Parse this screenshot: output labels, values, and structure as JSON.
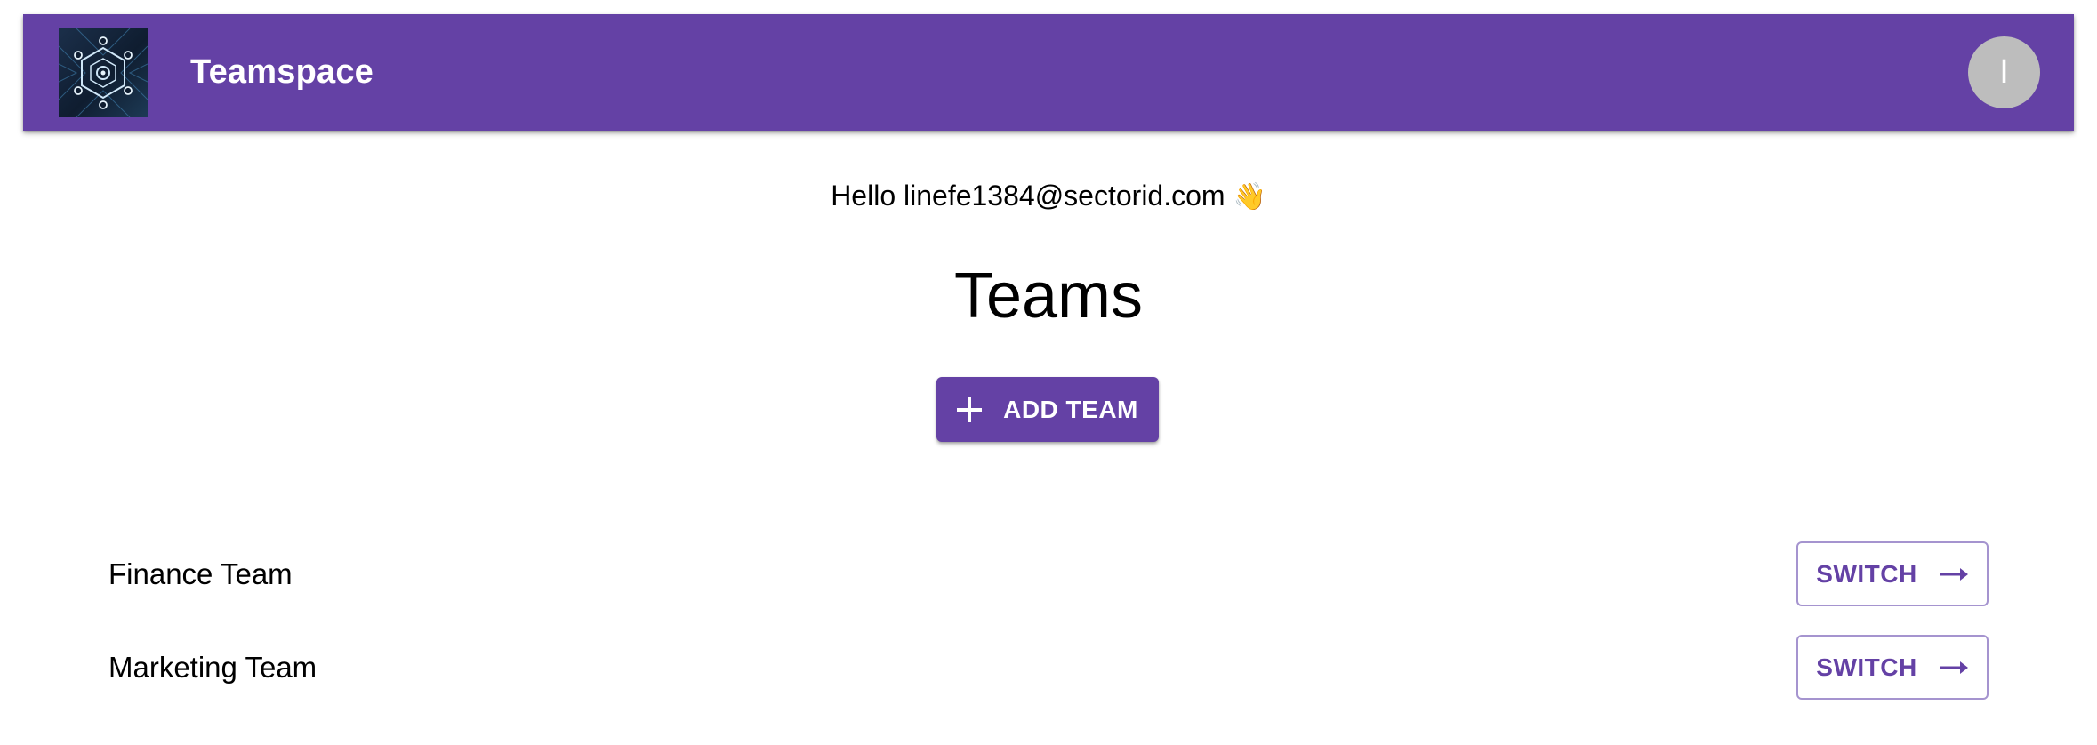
{
  "app": {
    "brand": "Teamspace",
    "logo_icon": "hexagon-network-logo-icon",
    "avatar_initial": "I",
    "accent_color": "#6441a5"
  },
  "greeting": {
    "text": "Hello linefe1384@sectorid.com",
    "emoji": "👋"
  },
  "heading": "Teams",
  "add_button": {
    "label": "ADD TEAM",
    "icon": "plus-icon"
  },
  "teams": [
    {
      "name": "Finance Team",
      "action": "SWITCH",
      "icon": "arrow-right-icon"
    },
    {
      "name": "Marketing Team",
      "action": "SWITCH",
      "icon": "arrow-right-icon"
    }
  ]
}
